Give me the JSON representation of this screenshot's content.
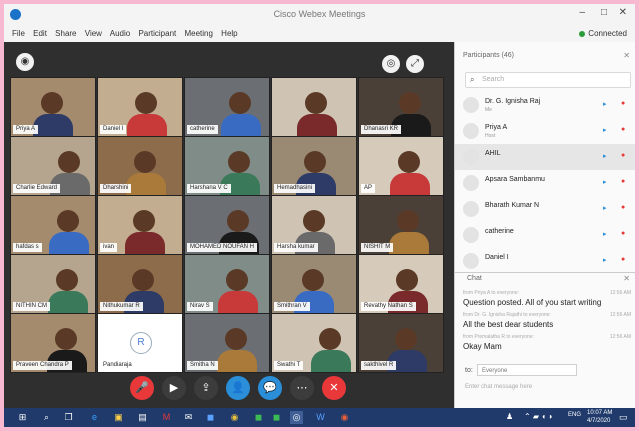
{
  "window": {
    "title": "Cisco Webex Meetings"
  },
  "menu": {
    "items": [
      "File",
      "Edit",
      "Share",
      "View",
      "Audio",
      "Participant",
      "Meeting",
      "Help"
    ],
    "connection": "Connected"
  },
  "video_tiles": [
    "Priya A",
    "Daniel I",
    "catherine",
    "",
    "Dhanasri KR",
    "Charlie Edward",
    "Dharshini",
    "Harshana V C",
    "Hemadhasini",
    "AP",
    "hafdas s",
    "ivan",
    "MOHAMED NOUFAN H",
    "Harsha kumar",
    "NISHIT M",
    "NITHIN CM",
    "Nithukumar R",
    "Nirav S",
    "Smithran V",
    "Revathy Nathan S",
    "Praveen Chandra P",
    "Pandiaraja",
    "Smitha N",
    "Swathi T",
    "sakthivel R"
  ],
  "panel": {
    "participants_header": "Participants (46)",
    "search_placeholder": "Search",
    "participants": [
      {
        "name": "Dr. G. Ignisha Raj",
        "role": "Me"
      },
      {
        "name": "Priya A",
        "role": "Host"
      },
      {
        "name": "AHIL",
        "role": ""
      },
      {
        "name": "Apsara Sambanmu",
        "role": ""
      },
      {
        "name": "Bharath Kumar N",
        "role": ""
      },
      {
        "name": "catherine",
        "role": ""
      },
      {
        "name": "Daniel I",
        "role": ""
      }
    ],
    "chat_header": "Chat",
    "messages": [
      {
        "meta": "from Priya A to everyone:",
        "time": "12:56 AM",
        "text": "Question posted. All of you start writing"
      },
      {
        "meta": "from Dr. G. Ignisha Rajathi to everyone:",
        "time": "12:56 AM",
        "text": "All the best dear students"
      },
      {
        "meta": "from Premalatha R to everyone:",
        "time": "12:56 AM",
        "text": "Okay Mam"
      }
    ],
    "to_label": "to:",
    "to_value": "Everyone",
    "chat_placeholder": "Enter chat message here"
  },
  "taskbar": {
    "time": "10:07 AM",
    "date": "4/7/2020",
    "lang": "ENG"
  },
  "colors": {
    "end_red": "#e8383a",
    "share_blue": "#2a8fd8",
    "brand": "#1a73c8"
  }
}
